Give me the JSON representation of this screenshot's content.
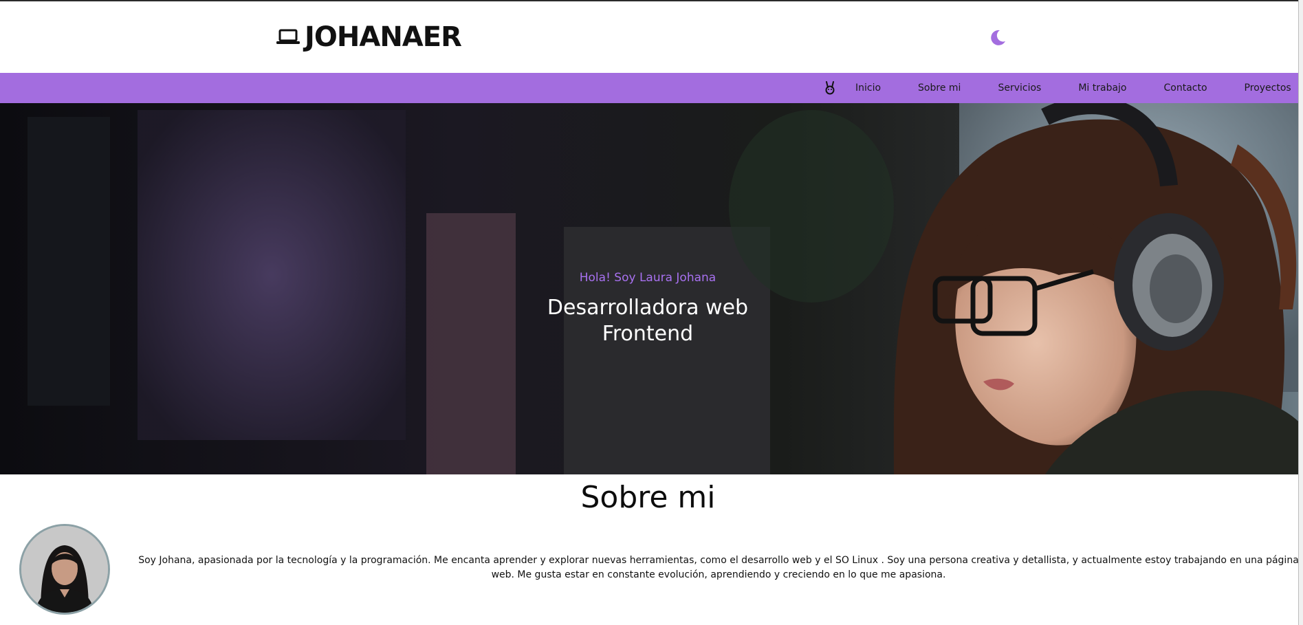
{
  "header": {
    "logo_text": "JOHANAER",
    "logo_icon": "laptop-icon",
    "theme_toggle_icon": "moon-icon"
  },
  "nav": {
    "icon": "rabbit-icon",
    "items": [
      {
        "label": "Inicio"
      },
      {
        "label": "Sobre mi"
      },
      {
        "label": "Servicios"
      },
      {
        "label": "Mi trabajo"
      },
      {
        "label": "Contacto"
      },
      {
        "label": "Proyectos"
      }
    ]
  },
  "hero": {
    "greeting": "Hola! Soy Laura Johana",
    "title_line1": "Desarrolladora web",
    "title_line2": "Frontend"
  },
  "about": {
    "title": "Sobre mi",
    "text": "Soy Johana, apasionada por la tecnología y la programación. Me encanta aprender y explorar nuevas herramientas, como el desarrollo web y el SO Linux . Soy una persona creativa y detallista, y actualmente estoy trabajando en una página web. Me gusta estar en constante evolución, aprendiendo y creciendo en lo que me apasiona."
  },
  "colors": {
    "accent": "#a36ddf",
    "greeting": "#a871f0",
    "hero_text": "#ffffff"
  }
}
